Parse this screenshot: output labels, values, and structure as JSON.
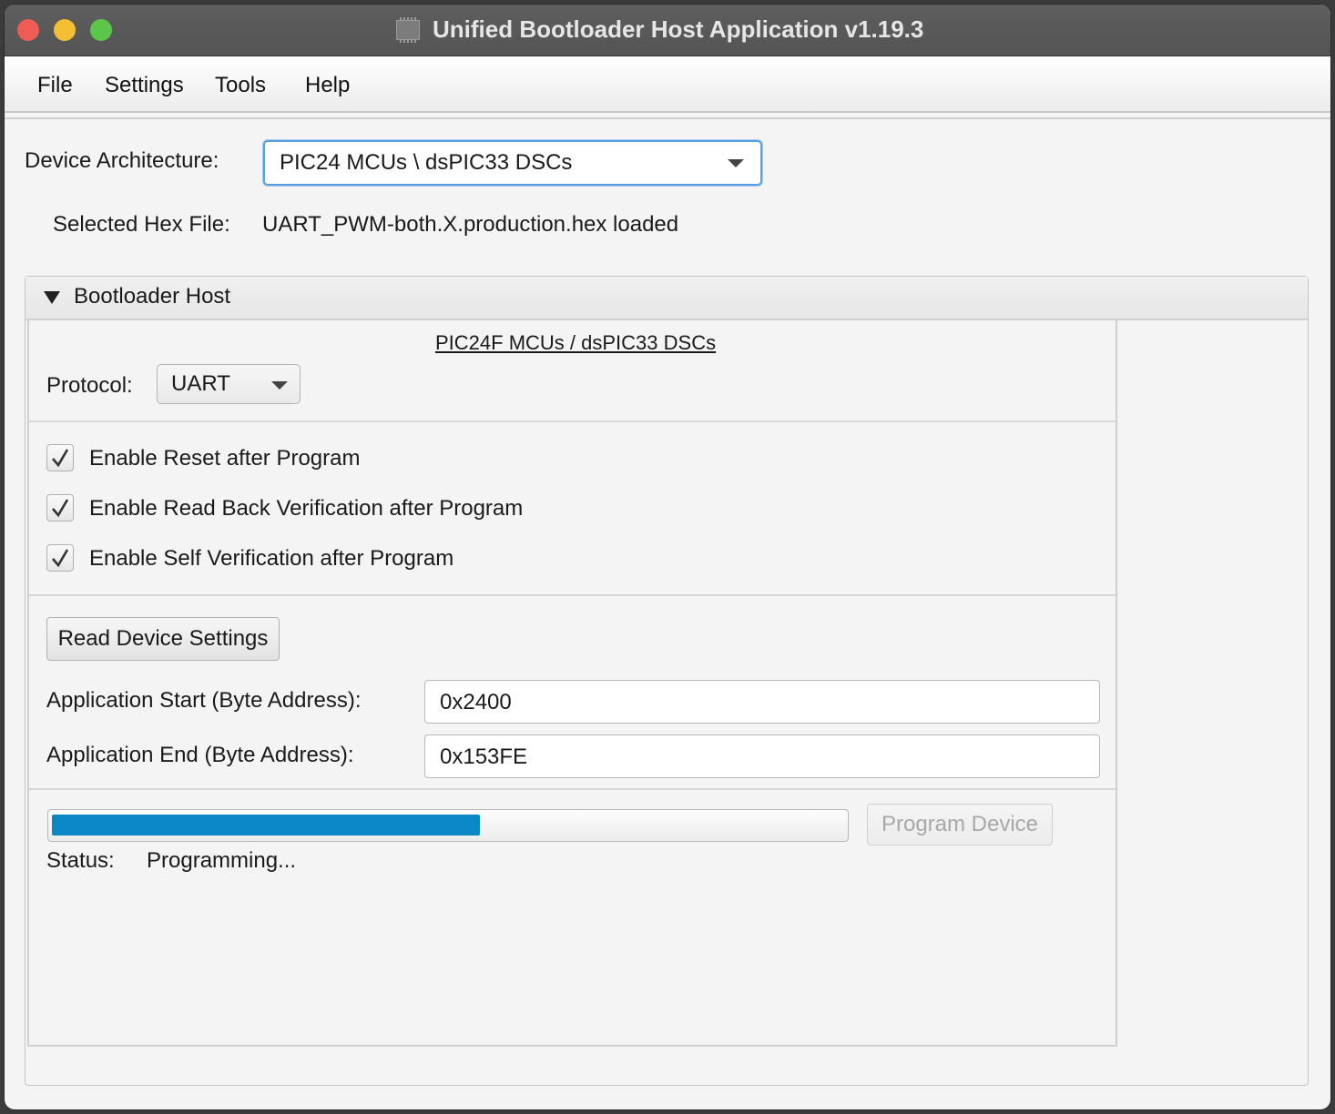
{
  "window": {
    "title": "Unified Bootloader Host Application v1.19.3"
  },
  "menu": {
    "items": [
      {
        "label": "File"
      },
      {
        "label": "Settings"
      },
      {
        "label": "Tools"
      },
      {
        "label": "Help"
      }
    ]
  },
  "device": {
    "architecture_label": "Device Architecture:",
    "architecture_value": "PIC24 MCUs \\ dsPIC33 DSCs",
    "hex_label": "Selected Hex File:",
    "hex_value": "UART_PWM-both.X.production.hex loaded"
  },
  "bootloader": {
    "header": "Bootloader Host",
    "subtitle": "PIC24F MCUs / dsPIC33 DSCs",
    "protocol_label": "Protocol:",
    "protocol_value": "UART",
    "options": [
      {
        "label": "Enable Reset after Program",
        "checked": true
      },
      {
        "label": "Enable Read Back Verification after Program",
        "checked": true
      },
      {
        "label": "Enable Self Verification after Program",
        "checked": true
      }
    ],
    "read_settings_button": "Read Device Settings",
    "app_start_label": "Application Start (Byte Address):",
    "app_start_value": "0x2400",
    "app_end_label": "Application End (Byte Address):",
    "app_end_value": "0x153FE",
    "program_button": "Program Device",
    "progress_fraction": 0.54,
    "progress_color": "#0a88c6",
    "status_label": "Status:",
    "status_value": "Programming..."
  }
}
